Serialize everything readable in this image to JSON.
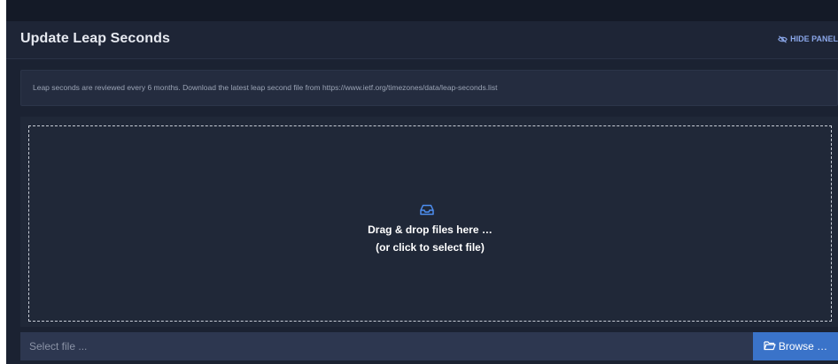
{
  "panel": {
    "title": "Update Leap Seconds",
    "hide_panel_label": "HIDE PANEL",
    "info_text": "Leap seconds are reviewed every 6 months. Download the latest leap second file from https://www.ietf.org/timezones/data/leap-seconds.list"
  },
  "dropzone": {
    "line1": "Drag & drop files here …",
    "line2": "(or click to select file)",
    "icon": "inbox-icon"
  },
  "file_input": {
    "placeholder": "Select file ...",
    "value": ""
  },
  "browse": {
    "label": "Browse …",
    "icon": "folder-open-icon"
  },
  "colors": {
    "background": "#1b2232",
    "accent": "#3a73c9",
    "link": "#8aa6e8"
  }
}
